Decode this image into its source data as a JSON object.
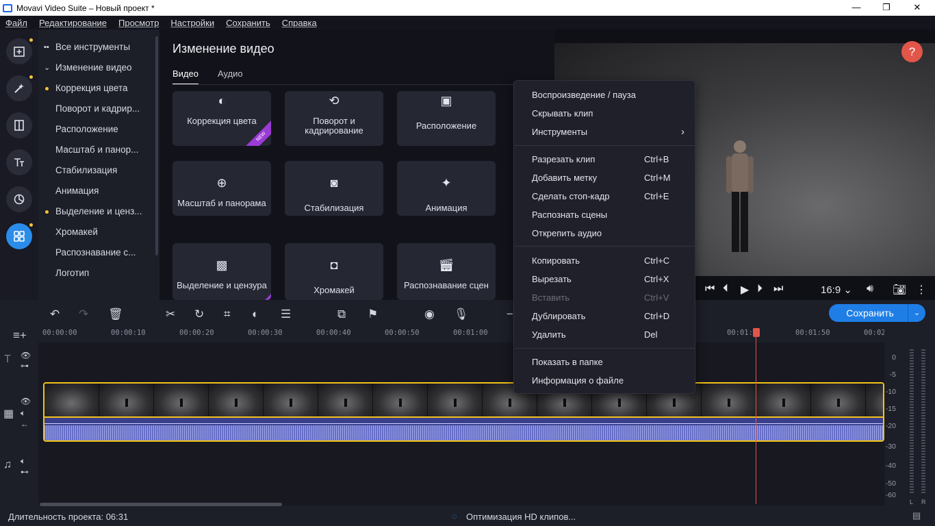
{
  "window": {
    "title": "Movavi Video Suite – Новый проект *",
    "minimize": "—",
    "maximize": "❐",
    "close": "✕"
  },
  "menu": [
    "Файл",
    "Редактирование",
    "Просмотр",
    "Настройки",
    "Сохранить",
    "Справка"
  ],
  "categories": [
    {
      "label": "Все инструменты",
      "icon": "grid"
    },
    {
      "label": "Изменение видео",
      "icon": "chevron-down"
    },
    {
      "label": "Коррекция цвета",
      "dot": true
    },
    {
      "label": "Поворот и кадрир..."
    },
    {
      "label": "Расположение"
    },
    {
      "label": "Масштаб и панор..."
    },
    {
      "label": "Стабилизация"
    },
    {
      "label": "Анимация"
    },
    {
      "label": "Выделение и ценз...",
      "dot": true
    },
    {
      "label": "Хромакей"
    },
    {
      "label": "Распознавание с..."
    },
    {
      "label": "Логотип"
    }
  ],
  "panel": {
    "title": "Изменение видео",
    "tabs": [
      "Видео",
      "Аудио"
    ],
    "tiles": [
      {
        "label": "Коррекция цвета",
        "icon": "contrast-icon",
        "new": "NEW"
      },
      {
        "label": "Поворот и кадрирование",
        "icon": "crop-rotate-icon"
      },
      {
        "label": "Расположение",
        "icon": "picture-in-picture-icon"
      },
      {
        "label": "Масштаб и панорама",
        "icon": "zoom-icon"
      },
      {
        "label": "Стабилизация",
        "icon": "stabilize-icon"
      },
      {
        "label": "Анимация",
        "icon": "animation-icon"
      },
      {
        "label": "Выделение и цензура",
        "icon": "mosaic-icon",
        "new": ""
      },
      {
        "label": "Хромакей",
        "icon": "chromakey-icon"
      },
      {
        "label": "Распознавание сцен",
        "icon": "clapper-icon"
      }
    ]
  },
  "preview": {
    "help": "?",
    "ratio": "16:9 ⌄"
  },
  "save_button": {
    "label": "Сохранить",
    "arrow": "⌄"
  },
  "ruler": [
    "00:00:00",
    "00:00:10",
    "00:00:20",
    "00:00:30",
    "00:00:40",
    "00:00:50",
    "00:01:00",
    "00:01:",
    "00:01:50",
    "00:02"
  ],
  "meter_labels": [
    "0",
    "-5",
    "-10",
    "-15",
    "-20",
    "-30",
    "-40",
    "-50",
    "-60"
  ],
  "meter_channels": [
    "L",
    "R"
  ],
  "status": {
    "duration": "Длительность проекта: 06:31",
    "optimizing": "Оптимизация HD клипов..."
  },
  "context_menu": [
    {
      "label": "Воспроизведение / пауза",
      "shortcut": ""
    },
    {
      "label": "Скрывать клип",
      "shortcut": ""
    },
    {
      "label": "Инструменты",
      "shortcut": "›"
    },
    {
      "label": "Разрезать клип",
      "shortcut": "Ctrl+B"
    },
    {
      "label": "Добавить метку",
      "shortcut": "Ctrl+M"
    },
    {
      "label": "Сделать стоп-кадр",
      "shortcut": "Ctrl+E"
    },
    {
      "label": "Распознать сцены",
      "shortcut": ""
    },
    {
      "label": "Открепить аудио",
      "shortcut": ""
    },
    {
      "label": "Копировать",
      "shortcut": "Ctrl+C"
    },
    {
      "label": "Вырезать",
      "shortcut": "Ctrl+X"
    },
    {
      "label": "Вставить",
      "shortcut": "Ctrl+V",
      "disabled": true
    },
    {
      "label": "Дублировать",
      "shortcut": "Ctrl+D"
    },
    {
      "label": "Удалить",
      "shortcut": "Del"
    },
    {
      "label": "Показать в папке",
      "shortcut": ""
    },
    {
      "label": "Информация о файле",
      "shortcut": ""
    }
  ],
  "colors": {
    "accent": "#1f7ee6",
    "clip_border": "#f2c318",
    "playhead": "#e2564a",
    "new_badge": "#9b3bd6"
  }
}
